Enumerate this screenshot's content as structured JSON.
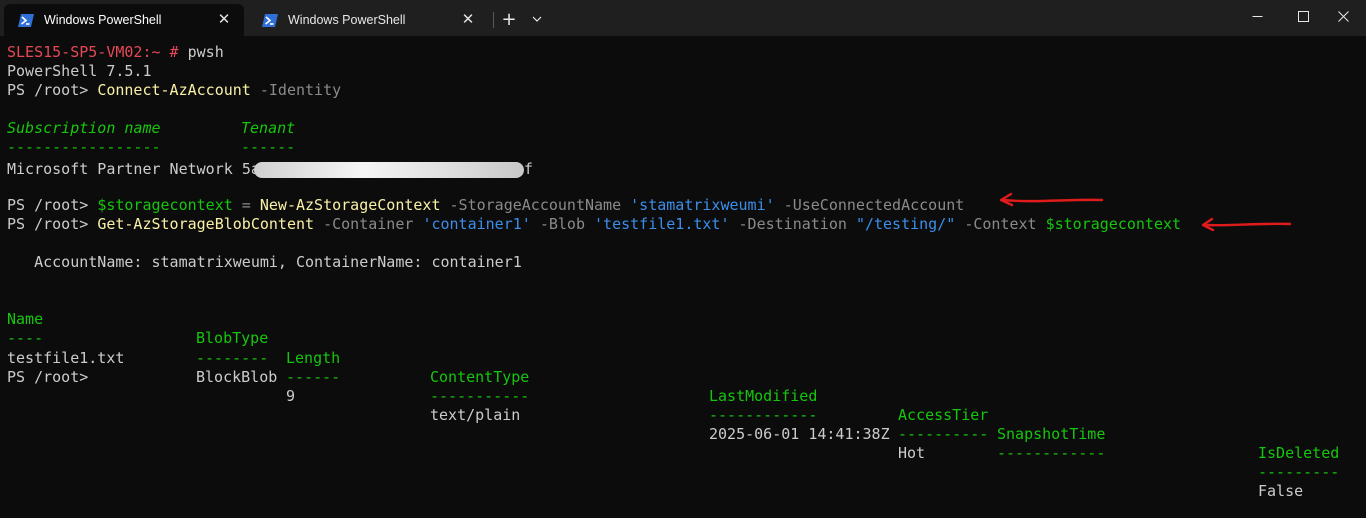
{
  "tabs": [
    {
      "label": "Windows PowerShell",
      "active": true
    },
    {
      "label": "Windows PowerShell",
      "active": false
    }
  ],
  "icons": {
    "new_tab": "plus-icon",
    "dropdown": "chevron-down-icon",
    "minimize": "minimize-icon",
    "maximize": "maximize-icon",
    "close": "close-icon"
  },
  "terminal": {
    "l1_prompt": "SLES15-SP5-VM02:~ #",
    "l1_cmd": "pwsh",
    "l2": "PowerShell 7.5.1",
    "ps_prompt": "PS /root>",
    "l3_cmd": "Connect-AzAccount",
    "l3_param": "-Identity",
    "sub_header_name": "Subscription name",
    "sub_header_tenant": "Tenant",
    "sub_underline_name": "-----------------",
    "sub_underline_tenant": "------",
    "sub_name": "Microsoft Partner Network",
    "tenant_start": "5a",
    "tenant_end": "f",
    "l6_var": "$storagecontext",
    "l6_eq": " = ",
    "l6_cmd": "New-AzStorageContext",
    "l6_p1": "-StorageAccountName",
    "l6_v1": "'stamatrixweumi'",
    "l6_p2": "-UseConnectedAccount",
    "l7_cmd": "Get-AzStorageBlobContent",
    "l7_p1": "-Container",
    "l7_v1": "'container1'",
    "l7_p2": "-Blob",
    "l7_v2": "'testfile1.txt'",
    "l7_p3": "-Destination",
    "l7_v3": "\"/testing/\"",
    "l7_p4": "-Context",
    "l7_v4": "$storagecontext",
    "account_line": "   AccountName: stamatrixweumi, ContainerName: container1",
    "final_prompt": "PS /root>"
  },
  "table": {
    "headers": [
      "Name",
      "BlobType",
      "Length",
      "ContentType",
      "LastModified",
      "AccessTier",
      "SnapshotTime",
      "IsDeleted"
    ],
    "underlines": [
      "----",
      "--------",
      "------",
      "-----------",
      "------------",
      "----------",
      "------------",
      "---------"
    ],
    "row": [
      "testfile1.txt",
      "BlockBlob",
      "9",
      "text/plain",
      "2025-06-01 14:41:38Z",
      "Hot",
      "",
      "False"
    ]
  },
  "colors": {
    "background": "#0c0c0c",
    "prompt_red": "#e74856",
    "cmdlet_yellow": "#f9f1a5",
    "string_blue": "#3b8eea",
    "variable_green": "#16c60c",
    "parameter_gray": "#8a8a8a",
    "annotation_arrow": "#e01b1b"
  }
}
